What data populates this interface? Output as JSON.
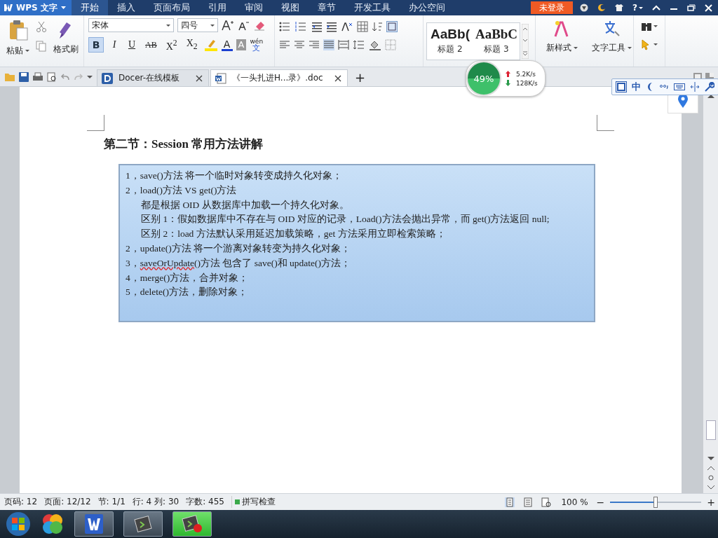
{
  "title_bar": {
    "logo": "WPS 文字",
    "menu_tabs": [
      {
        "label": "开始",
        "selected": true
      },
      {
        "label": "插入",
        "selected": false
      },
      {
        "label": "页面布局",
        "selected": false
      },
      {
        "label": "引用",
        "selected": false
      },
      {
        "label": "审阅",
        "selected": false
      },
      {
        "label": "视图",
        "selected": false
      },
      {
        "label": "章节",
        "selected": false
      },
      {
        "label": "开发工具",
        "selected": false
      },
      {
        "label": "办公空间",
        "selected": false
      }
    ],
    "login": "未登录",
    "help": "?"
  },
  "ribbon": {
    "paste": "粘贴",
    "format_painter": "格式刷",
    "font_name": "宋体",
    "font_size": "四号",
    "format_buttons": [
      {
        "kind": "toggle",
        "label": "B",
        "selected": true
      },
      {
        "kind": "toggle",
        "label": "I",
        "selected": false
      },
      {
        "kind": "toggle",
        "label": "U",
        "selected": false
      },
      {
        "kind": "toggle",
        "label": "AB",
        "selected": false
      },
      {
        "kind": "toggle",
        "label": "X$^{2}$",
        "selected": false
      },
      {
        "kind": "toggle",
        "label": "X$_{2}$",
        "selected": false
      },
      {
        "kind": "highlight"
      },
      {
        "kind": "color",
        "label": "A",
        "color": "#1a3fd0"
      },
      {
        "kind": "shade",
        "label": "A"
      },
      {
        "kind": "phonetic",
        "label": "wén",
        "char": "文"
      }
    ],
    "styles": [
      {
        "sample": "AaBb(",
        "label": "标题 2",
        "selected": false
      },
      {
        "sample": "AaBbC",
        "label": "标题 3",
        "selected": false
      }
    ],
    "new_style": "新样式",
    "text_tools": "文字工具"
  },
  "doc_tabs": {
    "tabs": [
      {
        "title": "Docer-在线模板",
        "kind": "docer",
        "selected": false
      },
      {
        "title": "《一头扎进H...录》.doc",
        "kind": "doc",
        "selected": true
      }
    ],
    "new_tab": "+"
  },
  "speed_widget": {
    "percent": "49%",
    "upload": "5.2K/s",
    "download": "128K/s"
  },
  "ime_bar": {
    "mode": "中"
  },
  "document": {
    "heading": "第二节：**Session** 常用方法讲解",
    "lines": [
      {
        "kind": "item",
        "segments": [
          {
            "text": "1，save()方法  将一个临时对象转变成持久化对象；",
            "misspelled": false
          }
        ]
      },
      {
        "kind": "item",
        "segments": [
          {
            "text": "2，load()方法 VS get()方法",
            "misspelled": false
          }
        ]
      },
      {
        "kind": "sub",
        "segments": [
          {
            "text": "都是根据 OID 从数据库中加载一个持久化对象。",
            "misspelled": false
          }
        ]
      },
      {
        "kind": "sub",
        "segments": [
          {
            "text": "区别 1：假如数据库中不存在与 OID 对应的记录，Load()方法会抛出异常，而 get()方法返回 null;",
            "misspelled": false
          }
        ]
      },
      {
        "kind": "sub",
        "segments": [
          {
            "text": "区别 2：load 方法默认采用延迟加载策略，get 方法采用立即检索策略；",
            "misspelled": false
          }
        ]
      },
      {
        "kind": "item",
        "segments": [
          {
            "text": "2，update()方法  将一个游离对象转变为持久化对象；",
            "misspelled": false
          }
        ]
      },
      {
        "kind": "item",
        "segments": [
          {
            "text": "3，",
            "misspelled": false
          },
          {
            "text": "saveOrUpdate",
            "misspelled": true
          },
          {
            "text": "()方法  包含了 save()和 update()方法；",
            "misspelled": false
          }
        ]
      },
      {
        "kind": "item",
        "segments": [
          {
            "text": "4，merge()方法，合并对象；",
            "misspelled": false
          }
        ]
      },
      {
        "kind": "item",
        "segments": [
          {
            "text": "5，delete()方法，删除对象；",
            "misspelled": false
          }
        ]
      }
    ]
  },
  "status_bar": {
    "fields": [
      "页码: 12",
      "页面: 12/12",
      "节: 1/1",
      "行: 4  列: 30",
      "字数: 455"
    ],
    "spell_check": "拼写检查",
    "zoom": "100 %",
    "zoom_out": "−",
    "zoom_in": "+",
    "zoom_slider": {
      "level": 0.5
    }
  }
}
